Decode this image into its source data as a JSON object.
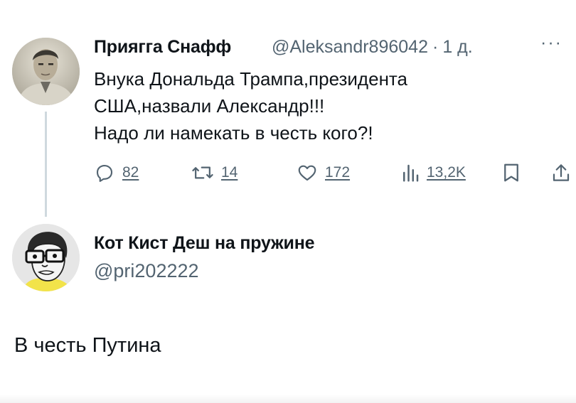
{
  "tweet": {
    "author_name": "Приягга Снафф",
    "author_handle": "@Aleksandr896042",
    "separator": "·",
    "time": "1 д.",
    "more": "···",
    "lines": [
      "Внука Дональда Трампа,президента",
      "США,назвали Александр!!!",
      "Надо ли намекать в честь кого?!"
    ],
    "actions": {
      "replies": "82",
      "retweets": "14",
      "likes": "172",
      "views": "13,2K"
    },
    "icons": [
      "reply-icon",
      "retweet-icon",
      "like-icon",
      "views-icon",
      "bookmark-icon",
      "share-icon"
    ]
  },
  "reply": {
    "author_name": "Кот Кист Деш на пружине",
    "author_handle": "@pri202222",
    "text": "В честь Путина"
  },
  "colors": {
    "text": "#0f1419",
    "secondary": "#536471",
    "thread_line": "#cfd9de",
    "background": "#ffffff"
  }
}
